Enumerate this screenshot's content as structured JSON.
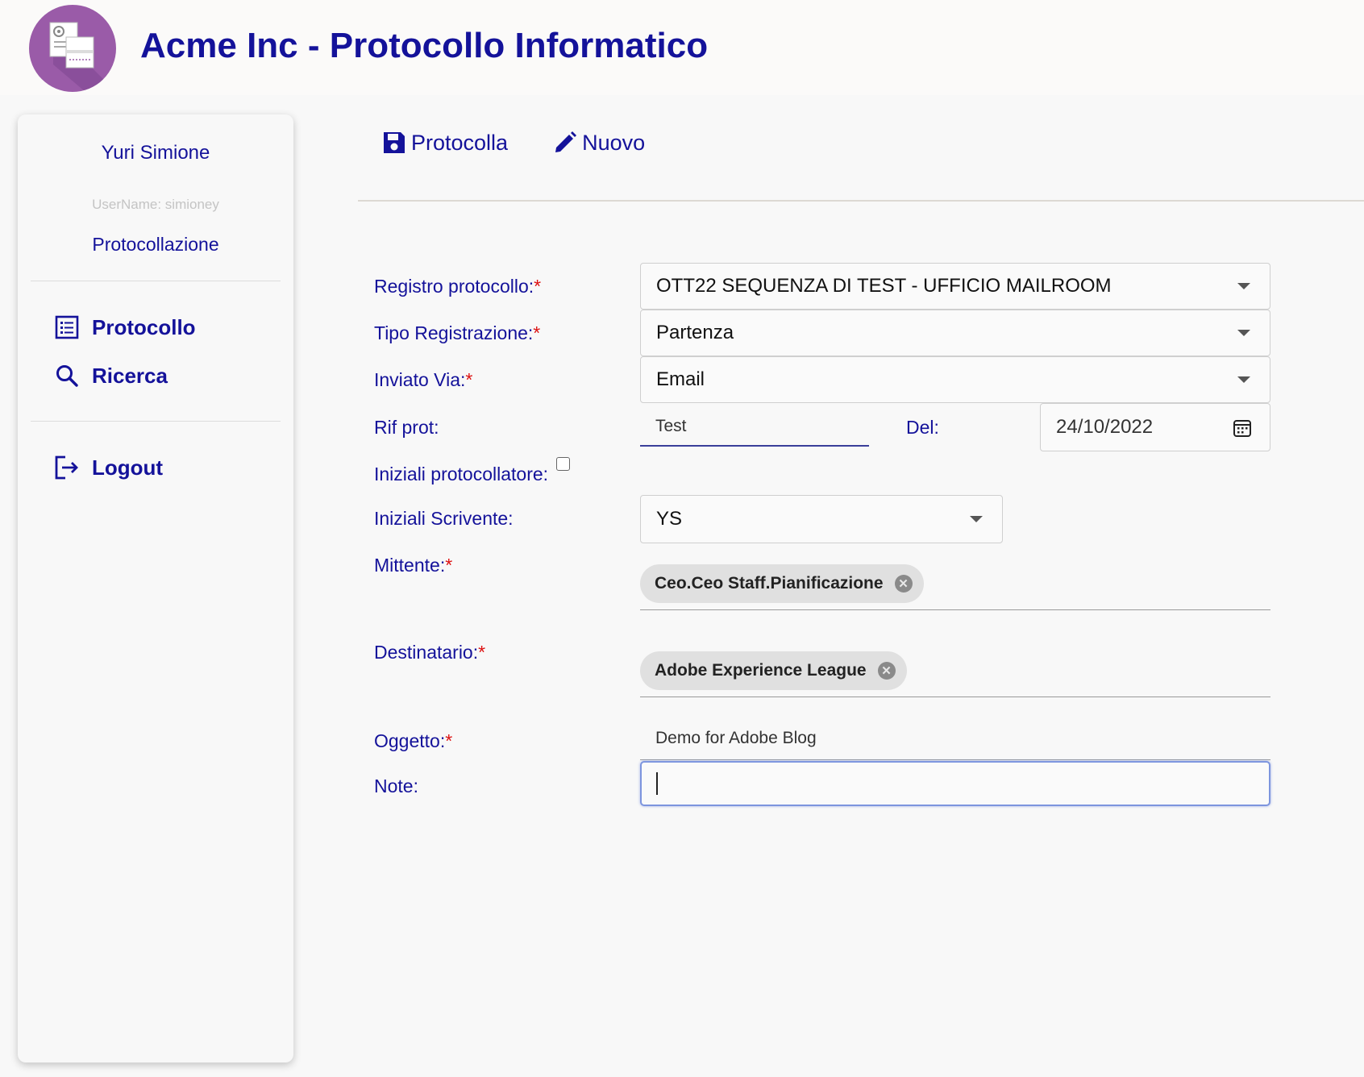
{
  "header": {
    "title": "Acme Inc - Protocollo Informatico",
    "logo_icon": "document-gear-icon",
    "logo_color": "#9a5ba8"
  },
  "user": {
    "name": "Yuri Simione",
    "username": "UserName: simioney",
    "section": "Protocollazione"
  },
  "nav": {
    "items": [
      {
        "label": "Protocollo",
        "icon": "list-icon"
      },
      {
        "label": "Ricerca",
        "icon": "search-icon"
      }
    ],
    "logout": {
      "label": "Logout",
      "icon": "logout-icon"
    }
  },
  "toolbar": {
    "save": {
      "label": "Protocolla",
      "icon": "save-icon"
    },
    "new": {
      "label": "Nuovo",
      "icon": "pencil-icon"
    }
  },
  "form": {
    "registro": {
      "label": "Registro protocollo:",
      "required": "*",
      "value": "OTT22 SEQUENZA DI TEST - UFFICIO MAILROOM"
    },
    "tipo": {
      "label": "Tipo Registrazione:",
      "required": "*",
      "value": "Partenza"
    },
    "inviato": {
      "label": "Inviato Via:",
      "required": "*",
      "value": "Email"
    },
    "rif": {
      "label": "Rif prot:",
      "value": "Test"
    },
    "del": {
      "label": "Del:",
      "value": "24/10/2022",
      "icon": "calendar-icon"
    },
    "iniziali_prot": {
      "label": "Iniziali protocollatore:",
      "checked": false
    },
    "iniziali_scr": {
      "label": "Iniziali Scrivente:",
      "value": "YS"
    },
    "mittente": {
      "label": "Mittente:",
      "required": "*",
      "chips": [
        "Ceo.Ceo Staff.Pianificazione"
      ]
    },
    "destinatario": {
      "label": "Destinatario:",
      "required": "*",
      "chips": [
        "Adobe Experience League"
      ]
    },
    "oggetto": {
      "label": "Oggetto:",
      "required": "*",
      "value": "Demo for Adobe Blog"
    },
    "note": {
      "label": "Note:",
      "value": ""
    }
  },
  "colors": {
    "accent": "#14129a",
    "required": "#dd1111",
    "background": "#f8f8f8"
  }
}
